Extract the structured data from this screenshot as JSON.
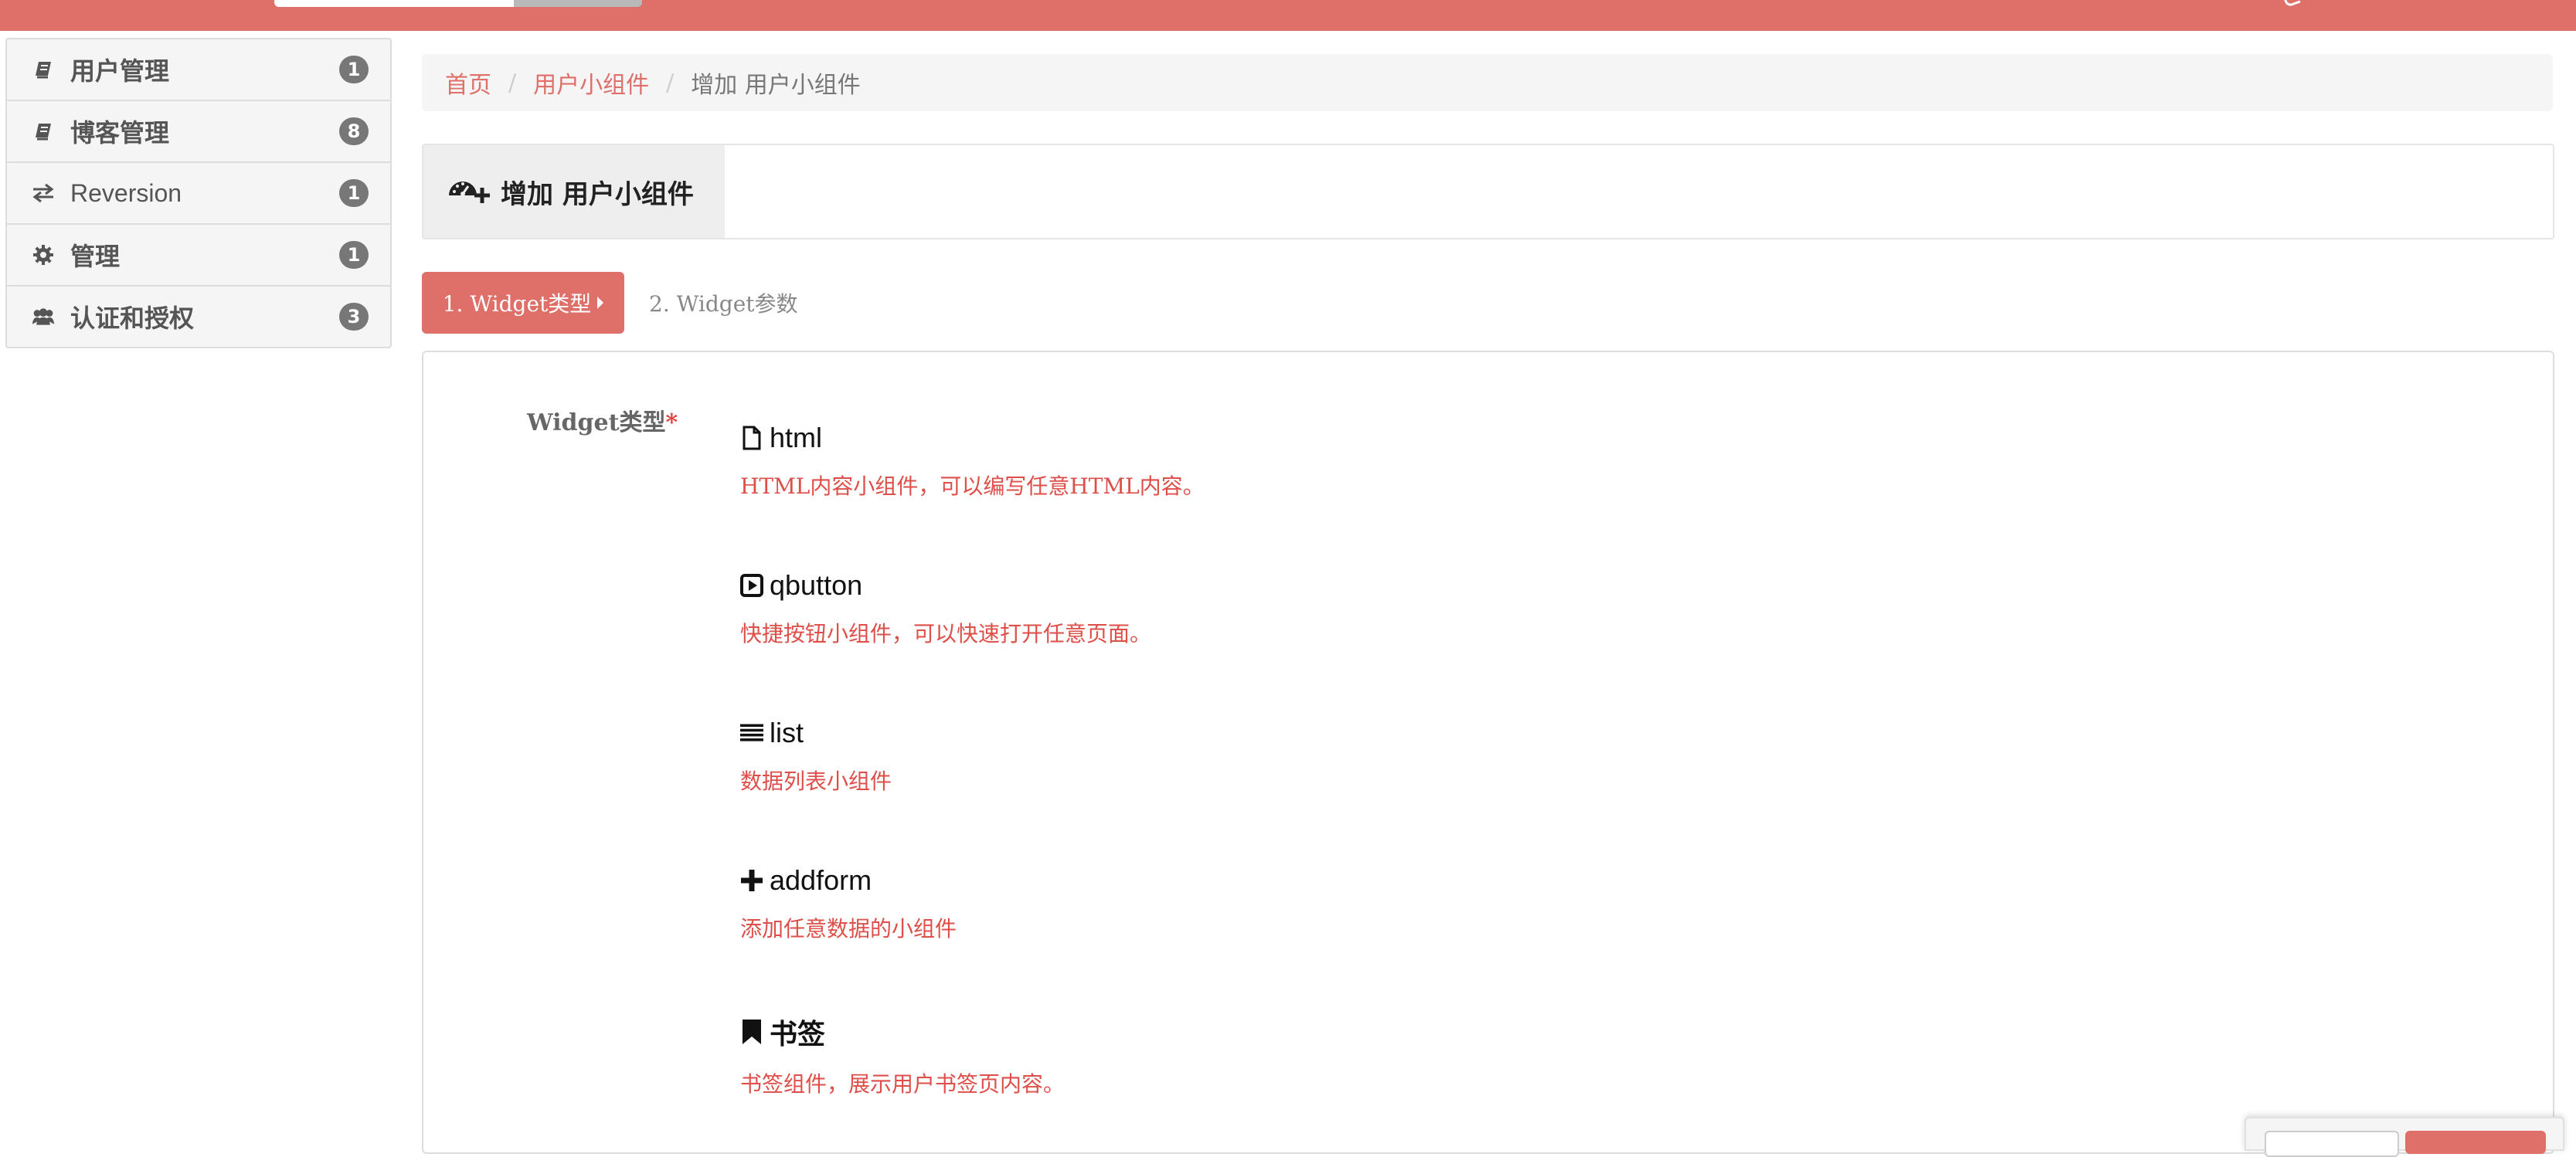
{
  "colors": {
    "brand": "#de6f69",
    "required": "#e23f3f",
    "description": "#de4f49",
    "badge": "#777777"
  },
  "navbar": {
    "search_icon": "search-box",
    "user_icon": "user-menu-caret"
  },
  "sidebar": {
    "items": [
      {
        "label": "用户管理",
        "badge": "1",
        "icon": "book-icon"
      },
      {
        "label": "博客管理",
        "badge": "8",
        "icon": "book-icon"
      },
      {
        "label": "Reversion",
        "badge": "1",
        "icon": "exchange-icon"
      },
      {
        "label": "管理",
        "badge": "1",
        "icon": "gear-icon"
      },
      {
        "label": "认证和授权",
        "badge": "3",
        "icon": "users-icon"
      }
    ]
  },
  "breadcrumb": {
    "items": [
      "首页",
      "用户小组件"
    ],
    "separator": "/",
    "active": "增加 用户小组件"
  },
  "page": {
    "title": "增加 用户小组件",
    "title_icon": "dashboard-plus-icon"
  },
  "wizard": {
    "step1": "1. Widget类型",
    "step2": "2. Widget参数"
  },
  "form": {
    "field_label": "Widget类型",
    "required_mark": "*",
    "options": [
      {
        "icon": "file-icon",
        "name": "html",
        "desc": "HTML内容小组件，可以编写任意HTML内容。"
      },
      {
        "icon": "play-square-icon",
        "name": "qbutton",
        "desc": "快捷按钮小组件，可以快速打开任意页面。"
      },
      {
        "icon": "list-icon",
        "name": "list",
        "desc": "数据列表小组件"
      },
      {
        "icon": "plus-icon",
        "name": "addform",
        "desc": "添加任意数据的小组件"
      },
      {
        "icon": "bookmark-icon",
        "name": "书签",
        "desc": "书签组件，展示用户书签页内容。"
      }
    ]
  }
}
